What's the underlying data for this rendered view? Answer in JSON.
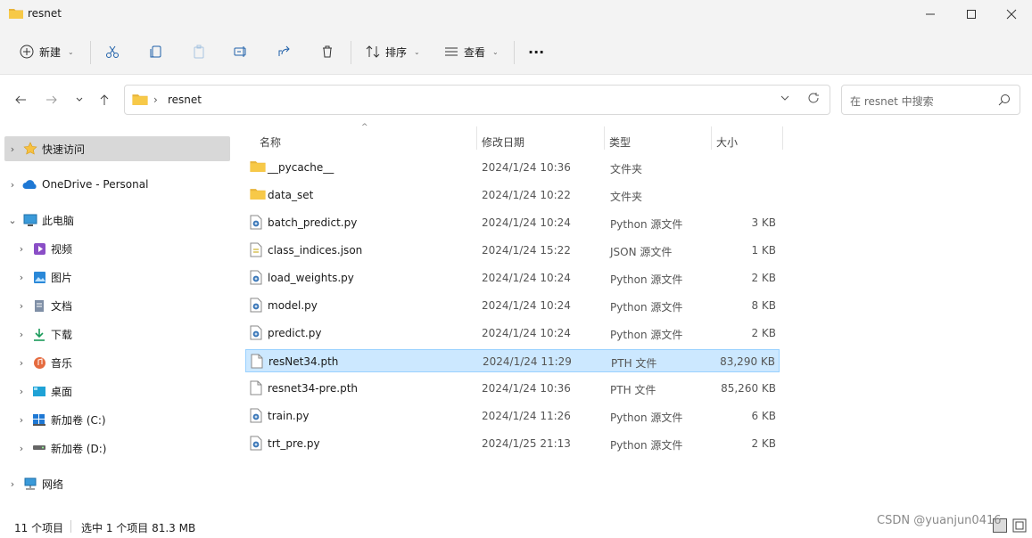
{
  "window": {
    "title": "resnet"
  },
  "toolbar": {
    "new_label": "新建",
    "sort_label": "排序",
    "view_label": "查看",
    "more_label": "..."
  },
  "address": {
    "crumb": "resnet",
    "search_placeholder": "在 resnet 中搜索"
  },
  "nav": {
    "quick_access": "快速访问",
    "onedrive": "OneDrive - Personal",
    "this_pc": "此电脑",
    "videos": "视频",
    "pictures": "图片",
    "documents": "文档",
    "downloads": "下载",
    "music": "音乐",
    "desktop": "桌面",
    "drive_c": "新加卷 (C:)",
    "drive_d": "新加卷 (D:)",
    "network": "网络"
  },
  "columns": {
    "name": "名称",
    "date": "修改日期",
    "type": "类型",
    "size": "大小"
  },
  "files": [
    {
      "name": "__pycache__",
      "date": "2024/1/24 10:36",
      "type": "文件夹",
      "size": "",
      "kind": "folder"
    },
    {
      "name": "data_set",
      "date": "2024/1/24 10:22",
      "type": "文件夹",
      "size": "",
      "kind": "folder"
    },
    {
      "name": "batch_predict.py",
      "date": "2024/1/24 10:24",
      "type": "Python 源文件",
      "size": "3 KB",
      "kind": "py"
    },
    {
      "name": "class_indices.json",
      "date": "2024/1/24 15:22",
      "type": "JSON 源文件",
      "size": "1 KB",
      "kind": "json"
    },
    {
      "name": "load_weights.py",
      "date": "2024/1/24 10:24",
      "type": "Python 源文件",
      "size": "2 KB",
      "kind": "py"
    },
    {
      "name": "model.py",
      "date": "2024/1/24 10:24",
      "type": "Python 源文件",
      "size": "8 KB",
      "kind": "py"
    },
    {
      "name": "predict.py",
      "date": "2024/1/24 10:24",
      "type": "Python 源文件",
      "size": "2 KB",
      "kind": "py"
    },
    {
      "name": "resNet34.pth",
      "date": "2024/1/24 11:29",
      "type": "PTH 文件",
      "size": "83,290 KB",
      "kind": "file",
      "selected": true
    },
    {
      "name": "resnet34-pre.pth",
      "date": "2024/1/24 10:36",
      "type": "PTH 文件",
      "size": "85,260 KB",
      "kind": "file"
    },
    {
      "name": "train.py",
      "date": "2024/1/24 11:26",
      "type": "Python 源文件",
      "size": "6 KB",
      "kind": "py"
    },
    {
      "name": "trt_pre.py",
      "date": "2024/1/25 21:13",
      "type": "Python 源文件",
      "size": "2 KB",
      "kind": "py"
    }
  ],
  "status": {
    "count": "11 个项目",
    "selection": "选中 1 个项目  81.3 MB"
  },
  "watermark": "CSDN @yuanjun0416",
  "colors": {
    "selection_bg": "#cce8ff",
    "folder": "#f7c948",
    "accent": "#0067c0"
  }
}
